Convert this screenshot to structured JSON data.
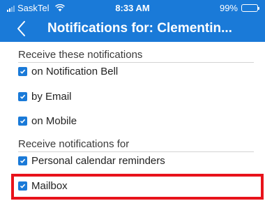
{
  "status": {
    "carrier": "SaskTel",
    "time": "8:33 AM",
    "battery_text": "99%",
    "battery_level": 0.99
  },
  "nav": {
    "title": "Notifications for: Clementin..."
  },
  "sections": [
    {
      "label": "Receive these notifications",
      "items": [
        {
          "label": "on Notification Bell",
          "checked": true
        },
        {
          "label": "by Email",
          "checked": true
        },
        {
          "label": "on Mobile",
          "checked": true
        }
      ]
    },
    {
      "label": "Receive notifications for",
      "items": [
        {
          "label": "Personal calendar reminders",
          "checked": true
        },
        {
          "label": "Mailbox",
          "checked": true
        }
      ]
    }
  ],
  "colors": {
    "header": "#1a7ad8",
    "checkbox": "#1a7ad8",
    "highlight": "#e8131b"
  }
}
